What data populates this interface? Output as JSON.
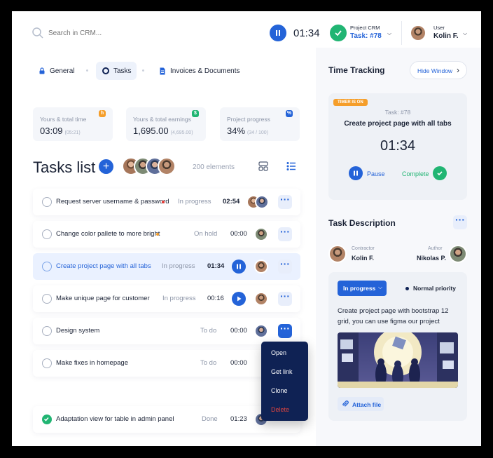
{
  "search": {
    "placeholder": "Search in CRM..."
  },
  "header": {
    "timer": "01:34",
    "project_label": "Project CRM",
    "project_task": "Task: #78",
    "user_label": "User",
    "user_name": "Kolin F."
  },
  "tabs": [
    {
      "label": "General",
      "icon": "lock-icon"
    },
    {
      "label": "Tasks",
      "icon": "circle-icon"
    },
    {
      "label": "Invoices & Documents",
      "icon": "document-icon"
    }
  ],
  "stats": [
    {
      "label": "Yours & total time",
      "value": "03:09",
      "sub": "(05:21)",
      "badge": "h",
      "color": "#f59e2a"
    },
    {
      "label": "Yours & total earnings",
      "value": "1,695.00",
      "sub": "(4,695.00)",
      "badge": "$",
      "color": "#21b573"
    },
    {
      "label": "Project progress",
      "value": "34%",
      "sub": "(34 / 100)",
      "badge": "%",
      "color": "#2463d8"
    }
  ],
  "tasks_list": {
    "title": "Tasks list",
    "count": "200 elements"
  },
  "tasks": [
    {
      "name": "Request server username & password",
      "status": "In progress",
      "time": "02:54",
      "dot": "#e53935",
      "done": false
    },
    {
      "name": "Change color pallete to more bright",
      "status": "On hold",
      "time": "00:00",
      "dot": "#f59e2a",
      "done": false
    },
    {
      "name": "Create project page with all tabs",
      "status": "In progress",
      "time": "01:34",
      "dot": "",
      "done": false
    },
    {
      "name": "Make unique page for customer",
      "status": "In progress",
      "time": "00:16",
      "dot": "",
      "done": false
    },
    {
      "name": "Design system",
      "status": "To do",
      "time": "00:00",
      "dot": "",
      "done": false
    },
    {
      "name": "Make fixes in homepage",
      "status": "To do",
      "time": "00:00",
      "dot": "",
      "done": false
    },
    {
      "name": "Adaptation view for table in admin panel",
      "status": "Done",
      "time": "01:23",
      "dot": "",
      "done": true
    }
  ],
  "context_menu": [
    "Open",
    "Get link",
    "Clone",
    "Delete"
  ],
  "time_tracking": {
    "title": "Time Tracking",
    "hide_button": "Hide Window",
    "badge": "TIMER IS ON",
    "task_no": "Task: #78",
    "task_title": "Create project page with all tabs",
    "timer": "01:34",
    "pause": "Pause",
    "complete": "Complete"
  },
  "task_description": {
    "title": "Task Description",
    "contractor_label": "Contractor",
    "contractor_name": "Kolin F.",
    "author_label": "Author",
    "author_name": "Nikolas P.",
    "status": "In progress",
    "priority": "Normal priority",
    "text": "Create project page with bootstrap 12 grid, you can use figma our project",
    "attach": "Attach file"
  },
  "colors": {
    "accent": "#2463d8",
    "success": "#21b573",
    "navy": "#0f2254"
  }
}
